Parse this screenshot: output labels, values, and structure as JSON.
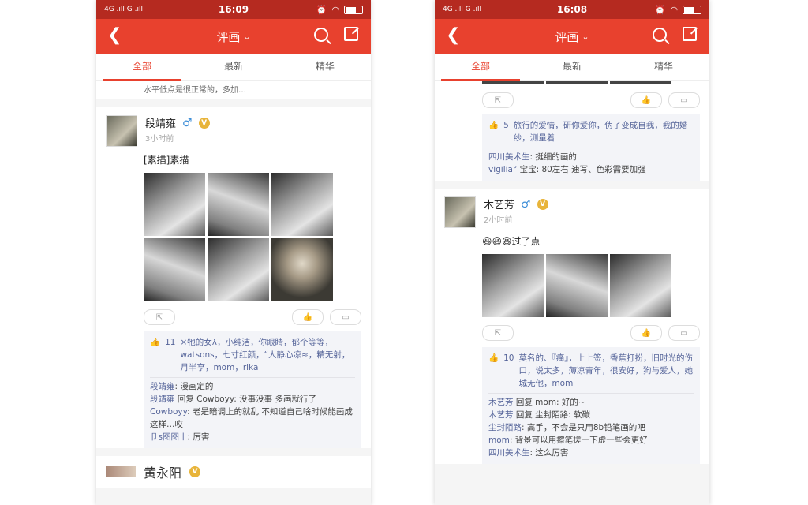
{
  "left": {
    "status": {
      "network": "4G .ill G .ill",
      "time": "16:09"
    },
    "nav": {
      "title": "评画"
    },
    "tabs": [
      "全部",
      "最新",
      "精华"
    ],
    "partial_text": "水平低点是很正常的，多加…",
    "post": {
      "name": "段靖雍",
      "time_ago": "3小时前",
      "text": "[素描]素描",
      "likes_count": "11",
      "likes_names": "×牠的女λ，小纯洁，你眼睛，郁个等等，watsons，七寸红颜，“人静心凉≈，精无射，月半亨，mom，rika",
      "comments": [
        {
          "who": "段靖雍",
          "text": ": 漫画定的"
        },
        {
          "who": "段靖雍",
          "text": " 回复 Cowboyy: 没事没事 多画就行了"
        },
        {
          "who": "Cowboyy",
          "text": ": 老是暗调上的就乱 不知道自己啥时候能画成这样…哎"
        },
        {
          "who": "卩s图图丨",
          "text": ": 厉害"
        }
      ]
    },
    "next_name": "黄永阳"
  },
  "right": {
    "status": {
      "network": "4G .ill G .ill",
      "time": "16:08"
    },
    "nav": {
      "title": "评画"
    },
    "tabs": [
      "全部",
      "最新",
      "精华"
    ],
    "top_block": {
      "likes_count": "5",
      "likes_names": "旅行的爱情，研你爱你，伪了变成自我，我的婚纱，测量着",
      "comments": [
        {
          "who": "四川美术生",
          "text": ": 挺细的画的"
        },
        {
          "who": "vigilia°",
          "text": " 宝宝: 80左右 速写、色彩需要加强"
        }
      ]
    },
    "post": {
      "name": "木艺芳",
      "time_ago": "2小时前",
      "text": "😆😆😆过了点",
      "likes_count": "10",
      "likes_names": "莫名的、『痛』，上上签，香蕉打扮，旧时光的伤口，说太多，薄凉青年，很安好，狗与爱人，她城无他，mom",
      "comments": [
        {
          "who": "木艺芳",
          "text": " 回复 mom: 好的~"
        },
        {
          "who": "木艺芳",
          "text": " 回复 尘封陌路: 软碳"
        },
        {
          "who": "尘封陌路",
          "text": ": 高手，不会是只用8b铅笔画的吧"
        },
        {
          "who": "mom",
          "text": ": 背景可以用擦笔搓一下虚一些会更好"
        },
        {
          "who": "四川美术生",
          "text": ": 这么厉害"
        }
      ]
    }
  }
}
